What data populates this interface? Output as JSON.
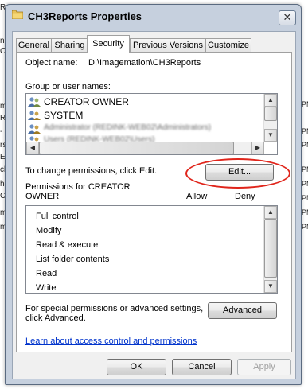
{
  "background": {
    "left_fragments": [
      "Re",
      "nRe",
      "Off",
      "",
      "",
      "",
      "me",
      "Re",
      "- S",
      "rsio",
      "Exc",
      "clie",
      "hen",
      "Che",
      "me",
      "me"
    ],
    "right_fragments": [
      "PM",
      "PM",
      "PM",
      "PM",
      "PM",
      "PM",
      "PM",
      "PM"
    ]
  },
  "window": {
    "title": "CH3Reports Properties",
    "close_glyph": "✕"
  },
  "tabs": [
    {
      "label": "General"
    },
    {
      "label": "Sharing"
    },
    {
      "label": "Security"
    },
    {
      "label": "Previous Versions"
    },
    {
      "label": "Customize"
    }
  ],
  "object_name": {
    "label": "Object name:",
    "value": "D:\\Imagemation\\CH3Reports"
  },
  "groups": {
    "label": "Group or user names:",
    "items": [
      {
        "name": "CREATOR OWNER"
      },
      {
        "name": "SYSTEM"
      },
      {
        "name": "Administrator (REDINK-WEB02\\Administrators)"
      },
      {
        "name": "Users (REDINK-WEB02\\Users)"
      }
    ]
  },
  "change_permissions": {
    "label": "To change permissions, click Edit.",
    "edit_button": "Edit..."
  },
  "permissions": {
    "label_line1": "Permissions for CREATOR",
    "label_line2": "OWNER",
    "allow_header": "Allow",
    "deny_header": "Deny",
    "items": [
      "Full control",
      "Modify",
      "Read & execute",
      "List folder contents",
      "Read",
      "Write"
    ]
  },
  "advanced": {
    "label_line1": "For special permissions or advanced settings,",
    "label_line2": "click Advanced.",
    "button": "Advanced"
  },
  "learn_link": "Learn about access control and permissions",
  "footer": {
    "ok": "OK",
    "cancel": "Cancel",
    "apply": "Apply"
  },
  "colors": {
    "highlight_ring": "#e0251b",
    "link": "#0033cc",
    "frame": "#c6d0de"
  }
}
